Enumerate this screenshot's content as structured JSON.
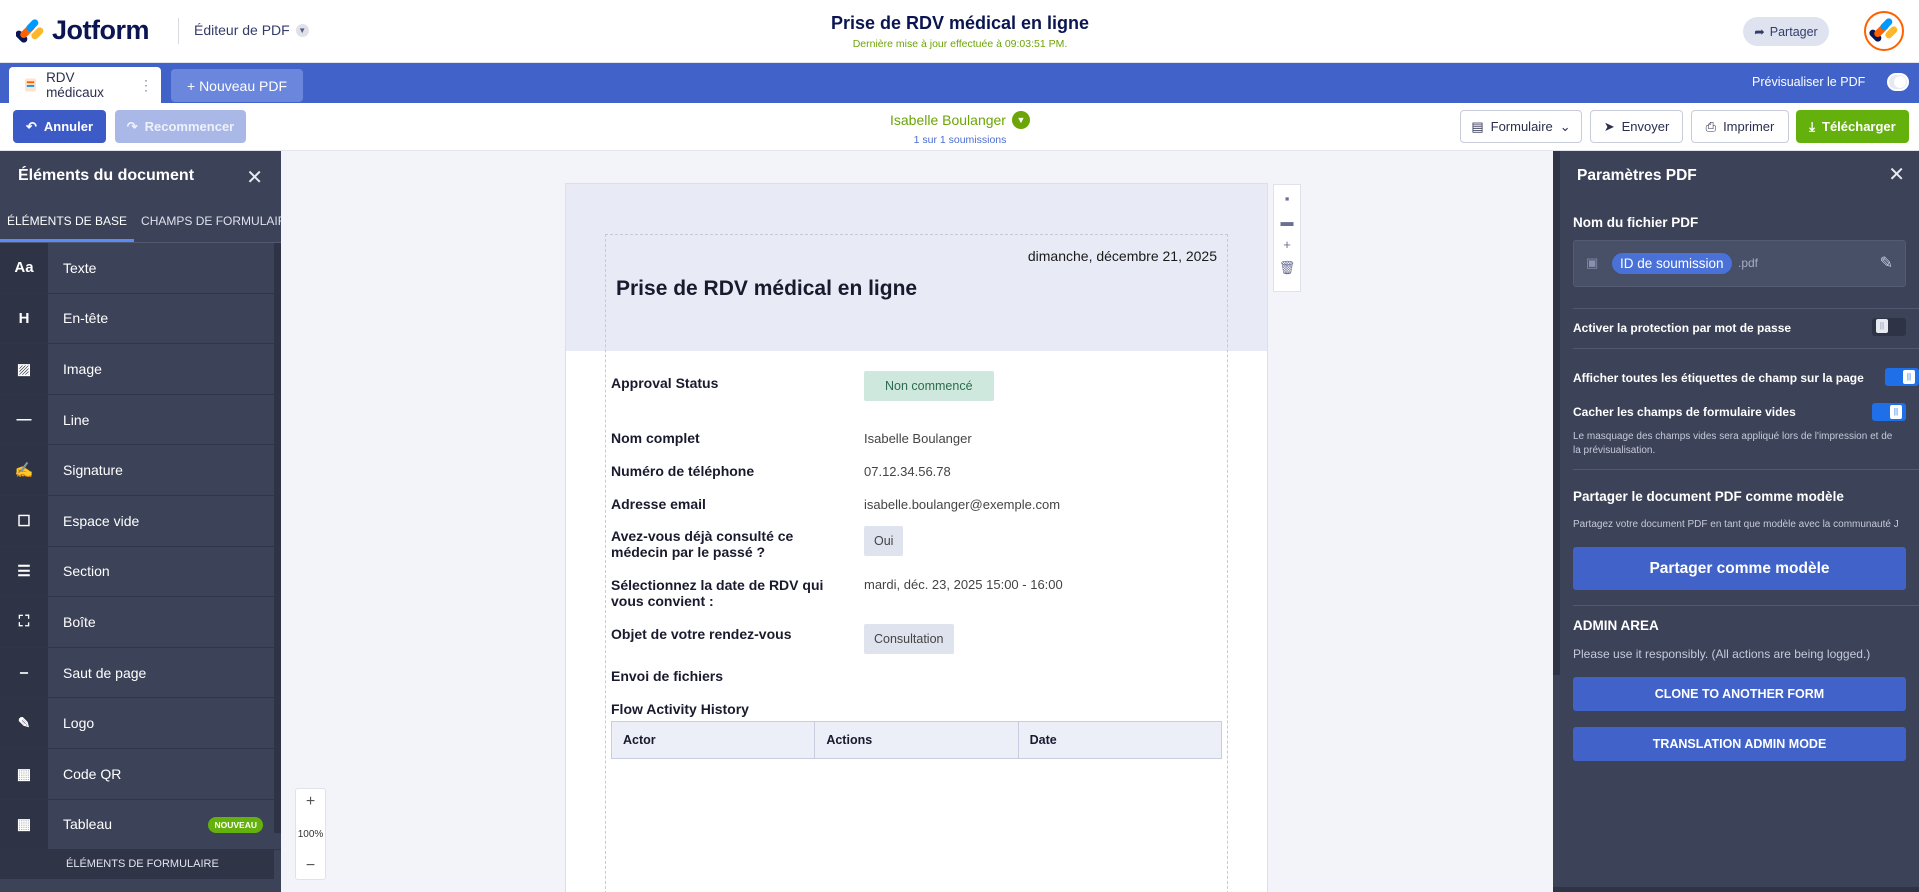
{
  "header": {
    "brand": "Jotform",
    "editor_label": "Éditeur de PDF",
    "title": "Prise de RDV médical en ligne",
    "subtitle": "Dernière mise à jour effectuée à 09:03:51 PM.",
    "share_label": "Partager"
  },
  "tabs": {
    "doc_tab": "RDV médicaux",
    "new_pdf": "+ Nouveau PDF",
    "preview_label": "Prévisualiser le PDF"
  },
  "actions": {
    "undo": "Annuler",
    "redo": "Recommencer",
    "submitter": "Isabelle Boulanger",
    "submission_count": "1 sur 1 soumissions",
    "form": "Formulaire",
    "send": "Envoyer",
    "print": "Imprimer",
    "download": "Télécharger"
  },
  "left_panel": {
    "title": "Éléments du document",
    "tabs": [
      "Éléments de base",
      "Champs de formulaire"
    ],
    "items": [
      {
        "icon": "text-icon",
        "glyph": "Aa",
        "label": "Texte"
      },
      {
        "icon": "header-icon",
        "glyph": "H",
        "label": "En-tête"
      },
      {
        "icon": "image-icon",
        "glyph": "▨",
        "label": "Image"
      },
      {
        "icon": "line-icon",
        "glyph": "—",
        "label": "Line"
      },
      {
        "icon": "signature-icon",
        "glyph": "✍",
        "label": "Signature"
      },
      {
        "icon": "spacer-icon",
        "glyph": "☐",
        "label": "Espace vide"
      },
      {
        "icon": "section-icon",
        "glyph": "☰",
        "label": "Section"
      },
      {
        "icon": "box-icon",
        "glyph": "⛶",
        "label": "Boîte"
      },
      {
        "icon": "page-break-icon",
        "glyph": "⎯",
        "label": "Saut de page"
      },
      {
        "icon": "logo-icon",
        "glyph": "✎",
        "label": "Logo"
      },
      {
        "icon": "qr-code-icon",
        "glyph": "▦",
        "label": "Code QR"
      },
      {
        "icon": "table-icon",
        "glyph": "▦",
        "label": "Tableau"
      }
    ],
    "new_badge": "NOUVEAU",
    "footer": "Éléments de formulaire"
  },
  "document": {
    "date": "dimanche, décembre 21, 2025",
    "title": "Prise de RDV médical en ligne",
    "fields": {
      "approval_label": "Approval Status",
      "approval_value": "Non commencé",
      "name_label": "Nom complet",
      "name_value": "Isabelle Boulanger",
      "phone_label": "Numéro de téléphone",
      "phone_value": "07.12.34.56.78",
      "email_label": "Adresse email",
      "email_value": "isabelle.boulanger@exemple.com",
      "prior_label": "Avez-vous déjà consulté ce médecin par le passé ?",
      "prior_value": "Oui",
      "date_label": "Sélectionnez la date de RDV qui vous convient :",
      "date_value": "mardi, déc. 23, 2025 15:00 - 16:00",
      "purpose_label": "Objet de votre rendez-vous",
      "purpose_value": "Consultation",
      "files_label": "Envoi de fichiers",
      "flow_label": "Flow Activity History"
    },
    "flow_columns": [
      "Actor",
      "Actions",
      "Date"
    ],
    "zoom": "100%"
  },
  "right_panel": {
    "title": "Paramètres PDF",
    "filename_label": "Nom du fichier PDF",
    "filename_chip": "ID de soumission",
    "filename_ext": ".pdf",
    "password_label": "Activer la protection par mot de passe",
    "password_on": false,
    "show_labels_label": "Afficher toutes les étiquettes de champ sur la page",
    "show_labels_on": true,
    "hide_empty_label": "Cacher les champs de formulaire vides",
    "hide_empty_on": true,
    "hide_empty_help": "Le masquage des champs vides sera appliqué lors de l'impression et de la prévisualisation.",
    "share_template_title": "Partager le document PDF comme modèle",
    "share_template_help": "Partagez votre document PDF en tant que modèle avec la communauté J",
    "share_template_btn": "Partager comme modèle",
    "admin_title": "ADMIN AREA",
    "admin_help": "Please use it responsibly. (All actions are being logged.)",
    "clone_btn": "CLONE TO ANOTHER FORM",
    "translation_btn": "TRANSLATION ADMIN MODE"
  },
  "colors": {
    "brand_navy": "#0a1551",
    "tab_blue": "#4062c9",
    "panel_dark": "#3c4257",
    "success_green": "#64b10d",
    "avatar_orange": "#ff6100"
  }
}
